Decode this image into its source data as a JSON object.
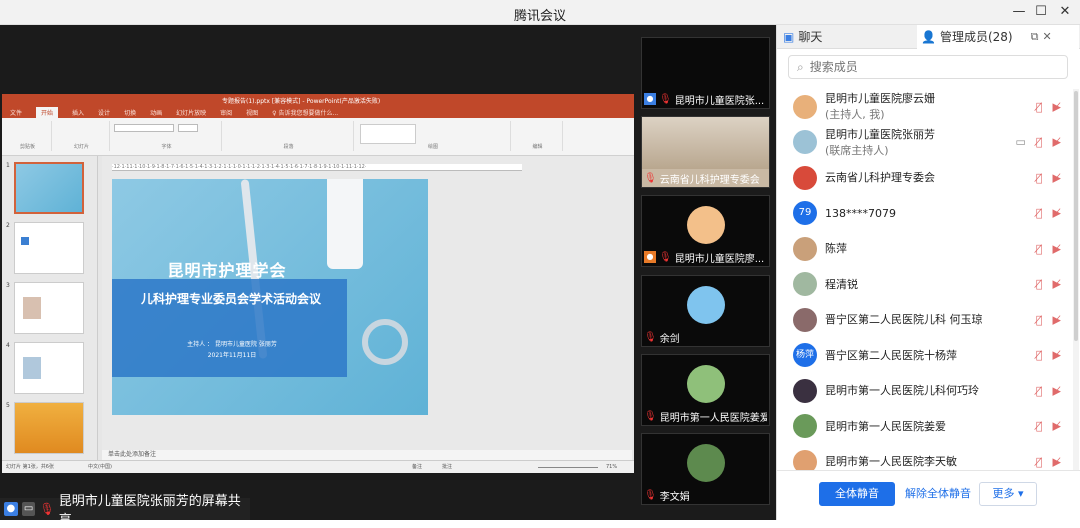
{
  "window": {
    "title": "腾讯会议",
    "minimize": "—",
    "maximize": "☐",
    "close": "✕"
  },
  "share_bar": {
    "label": "昆明市儿童医院张丽芳的屏幕共享"
  },
  "ppt": {
    "file_title": "专题报告(1).pptx [兼容模式] - PowerPoint(产品激活失败)",
    "tabs": [
      "文件",
      "开始",
      "插入",
      "设计",
      "切换",
      "动画",
      "幻灯片放映",
      "审阅",
      "视图",
      "♀ 告诉我您想要做什么..."
    ],
    "active_tab": "开始",
    "groups": [
      "剪贴板",
      "幻灯片",
      "字体",
      "段落",
      "绘图",
      "编辑"
    ],
    "ruler": "·12·1·11·1·10·1·9·1·8·1·7·1·6·1·5·1·4·1·3·1·2·1·1·1·0·1·1·1·2·1·3·1·4·1·5·1·6·1·7·1·8·1·9·1·10·1·11·1·12·",
    "slide": {
      "org": "昆明市护理学会",
      "topic": "儿科护理专业委员会学术活动会议",
      "host": "主持人 ： 昆明市儿童医院  张丽芳",
      "date": "2021年11月11日"
    },
    "thumb_numbers": [
      "1",
      "2",
      "3",
      "4",
      "5"
    ],
    "notes": "单击此处添加备注",
    "status_left": "幻灯片 第1张，共6张",
    "status_lang": "中文(中国)",
    "status_notes": "备注",
    "status_comments": "批注",
    "zoom": "71%"
  },
  "tiles": [
    {
      "name": "昆明市儿童医院张..."
    },
    {
      "name": "云南省儿科护理专委会"
    },
    {
      "name": "昆明市儿童医院廖..."
    },
    {
      "name": "余剑"
    },
    {
      "name": "昆明市第一人民医院姜爱"
    },
    {
      "name": "李文娟"
    }
  ],
  "panel": {
    "tab_chat": "聊天",
    "tab_members": "管理成员(28)",
    "search_placeholder": "搜索成员",
    "members": [
      {
        "name": "昆明市儿童医院廖云姗",
        "sub": "(主持人, 我)"
      },
      {
        "name": "昆明市儿童医院张丽芳",
        "sub": "(联席主持人)"
      },
      {
        "name": "云南省儿科护理专委会",
        "sub": ""
      },
      {
        "name": "138****7079",
        "sub": "",
        "avatar_text": "79"
      },
      {
        "name": "陈萍",
        "sub": ""
      },
      {
        "name": "程清锐",
        "sub": ""
      },
      {
        "name": "晋宁区第二人民医院儿科 何玉琼",
        "sub": ""
      },
      {
        "name": "晋宁区第二人民医院十杨萍",
        "sub": "",
        "avatar_text": "杨萍"
      },
      {
        "name": "昆明市第一人民医院儿科何巧玲",
        "sub": ""
      },
      {
        "name": "昆明市第一人民医院姜爱",
        "sub": ""
      },
      {
        "name": "昆明市第一人民医院李天敏",
        "sub": ""
      }
    ],
    "btn_mute_all": "全体静音",
    "btn_unmute_all": "解除全体静音",
    "btn_more": "更多 ▾"
  }
}
